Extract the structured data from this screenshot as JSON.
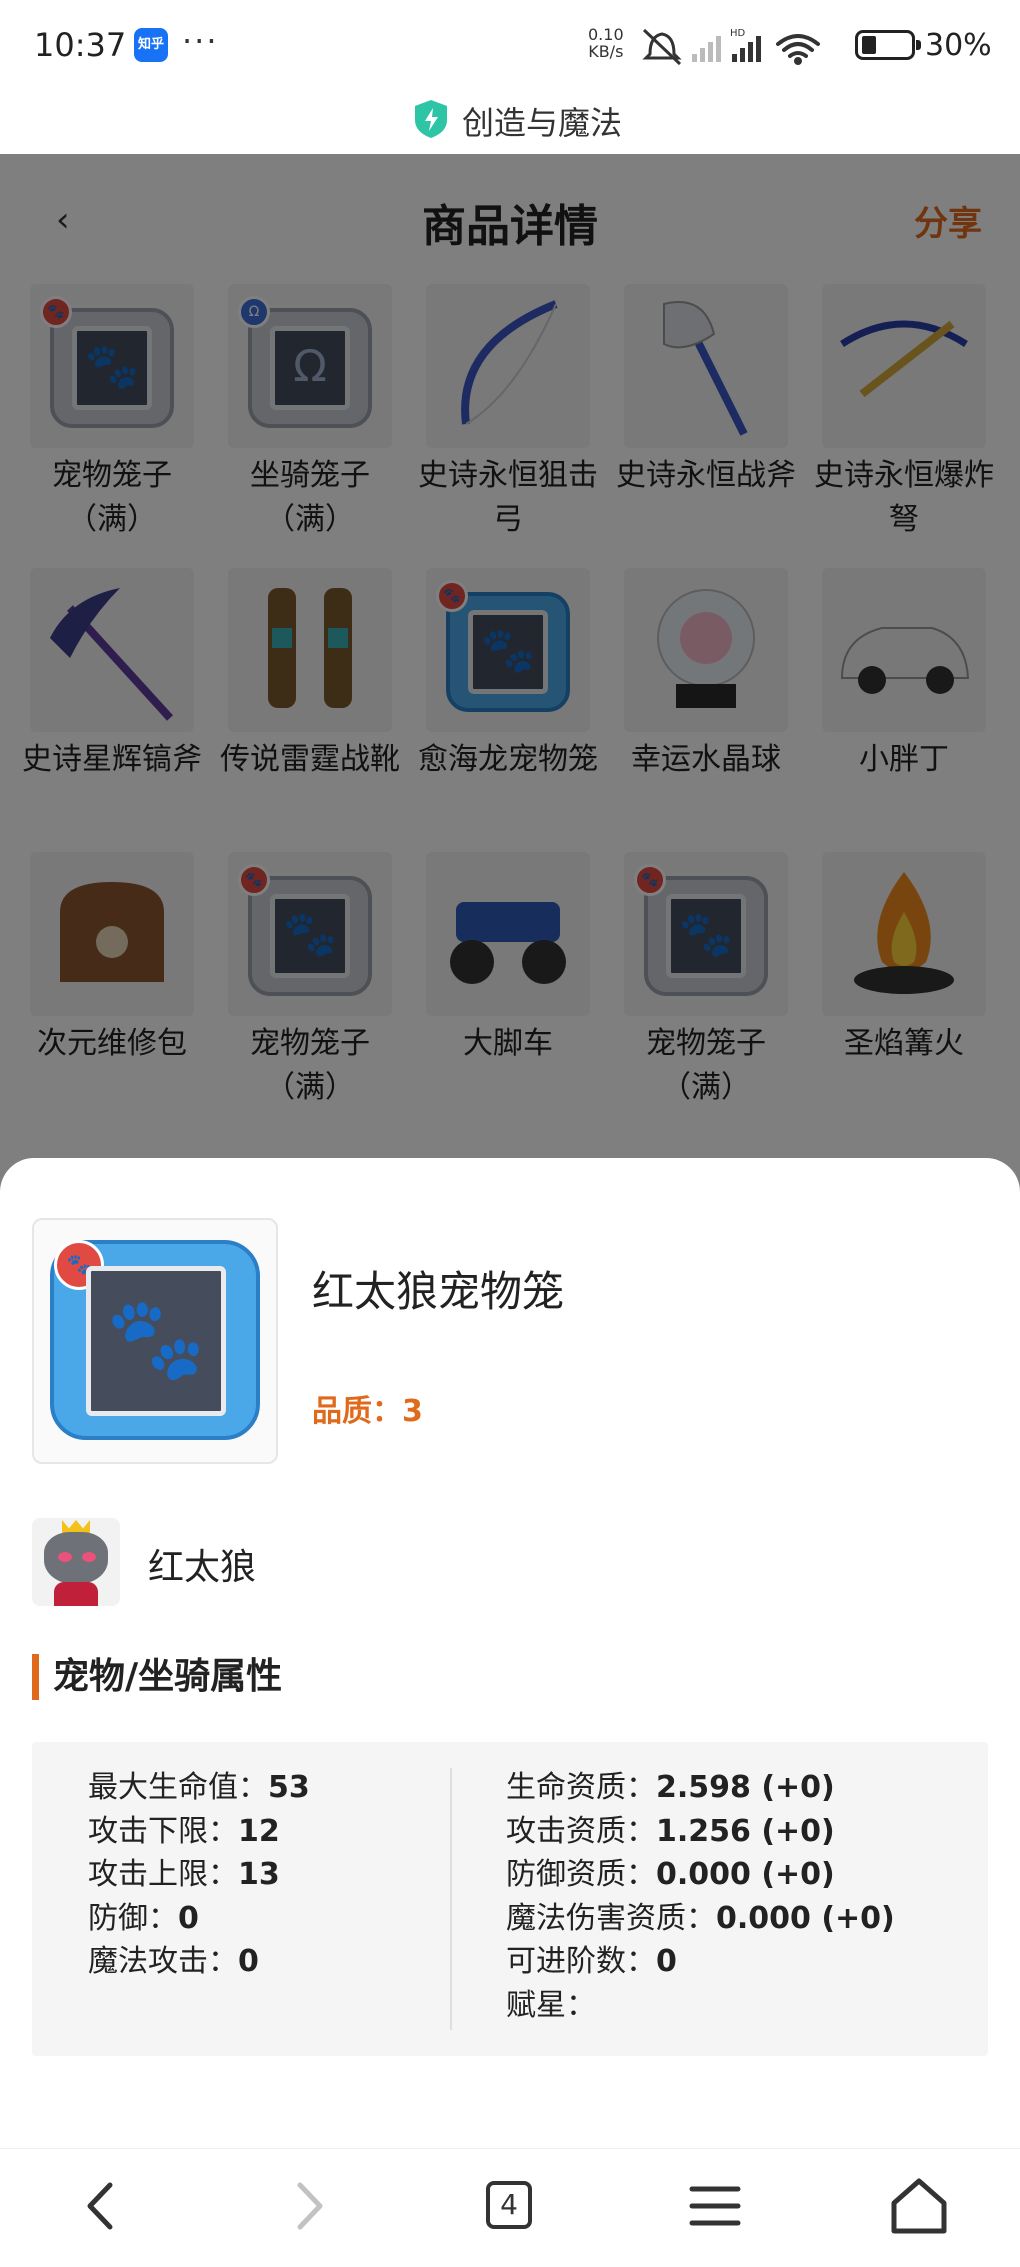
{
  "status_bar": {
    "time": "10:37",
    "notif_app": "知乎",
    "more": "···",
    "net_speed_value": "0.10",
    "net_speed_unit": "KB/s",
    "battery_pct": "30%"
  },
  "site": {
    "title": "创造与魔法"
  },
  "page": {
    "title": "商品详情",
    "share_label": "分享",
    "back_glyph": "‹"
  },
  "items": [
    {
      "name": "宠物笼子\n（满）",
      "icon": "pet-cage-icon"
    },
    {
      "name": "坐骑笼子\n（满）",
      "icon": "mount-cage-icon"
    },
    {
      "name": "史诗永恒狙击弓",
      "icon": "bow-icon"
    },
    {
      "name": "史诗永恒战斧",
      "icon": "battle-axe-icon"
    },
    {
      "name": "史诗永恒爆炸弩",
      "icon": "crossbow-icon"
    },
    {
      "name": "史诗星辉镐斧",
      "icon": "pickaxe-icon"
    },
    {
      "name": "传说雷霆战靴",
      "icon": "boots-icon"
    },
    {
      "name": "愈海龙宠物笼",
      "icon": "pet-cage-blue-icon"
    },
    {
      "name": "幸运水晶球",
      "icon": "crystal-ball-icon"
    },
    {
      "name": "小胖丁",
      "icon": "car-icon"
    },
    {
      "name": "次元维修包",
      "icon": "repair-bag-icon"
    },
    {
      "name": "宠物笼子\n（满）",
      "icon": "pet-cage-icon"
    },
    {
      "name": "大脚车",
      "icon": "monster-truck-icon"
    },
    {
      "name": "宠物笼子\n（满）",
      "icon": "pet-cage-icon"
    },
    {
      "name": "圣焰篝火",
      "icon": "campfire-icon"
    }
  ],
  "detail": {
    "name": "红太狼宠物笼",
    "quality_label": "品质：",
    "quality_value": "3",
    "owner_name": "红太狼",
    "section_title": "宠物/坐骑属性",
    "left_stats": [
      {
        "label": "最大生命值：",
        "value": "53"
      },
      {
        "label": "攻击下限：",
        "value": "12"
      },
      {
        "label": "攻击上限：",
        "value": "13"
      },
      {
        "label": "防御：",
        "value": "0"
      },
      {
        "label": "魔法攻击：",
        "value": "0"
      }
    ],
    "right_stats": [
      {
        "label": "生命资质：",
        "value": "2.598 (+0)"
      },
      {
        "label": "攻击资质：",
        "value": "1.256 (+0)"
      },
      {
        "label": "防御资质：",
        "value": "0.000 (+0)"
      },
      {
        "label": "魔法伤害资质：",
        "value": "0.000 (+0)"
      },
      {
        "label": "可进阶数：",
        "value": "0"
      },
      {
        "label": "赋星：",
        "value": ""
      }
    ]
  },
  "nav": {
    "tab_count": "4"
  },
  "colors": {
    "accent": "#e06a1c",
    "overlay": "rgba(0,0,0,0.5)",
    "panel_bg": "#f5f5f5"
  }
}
